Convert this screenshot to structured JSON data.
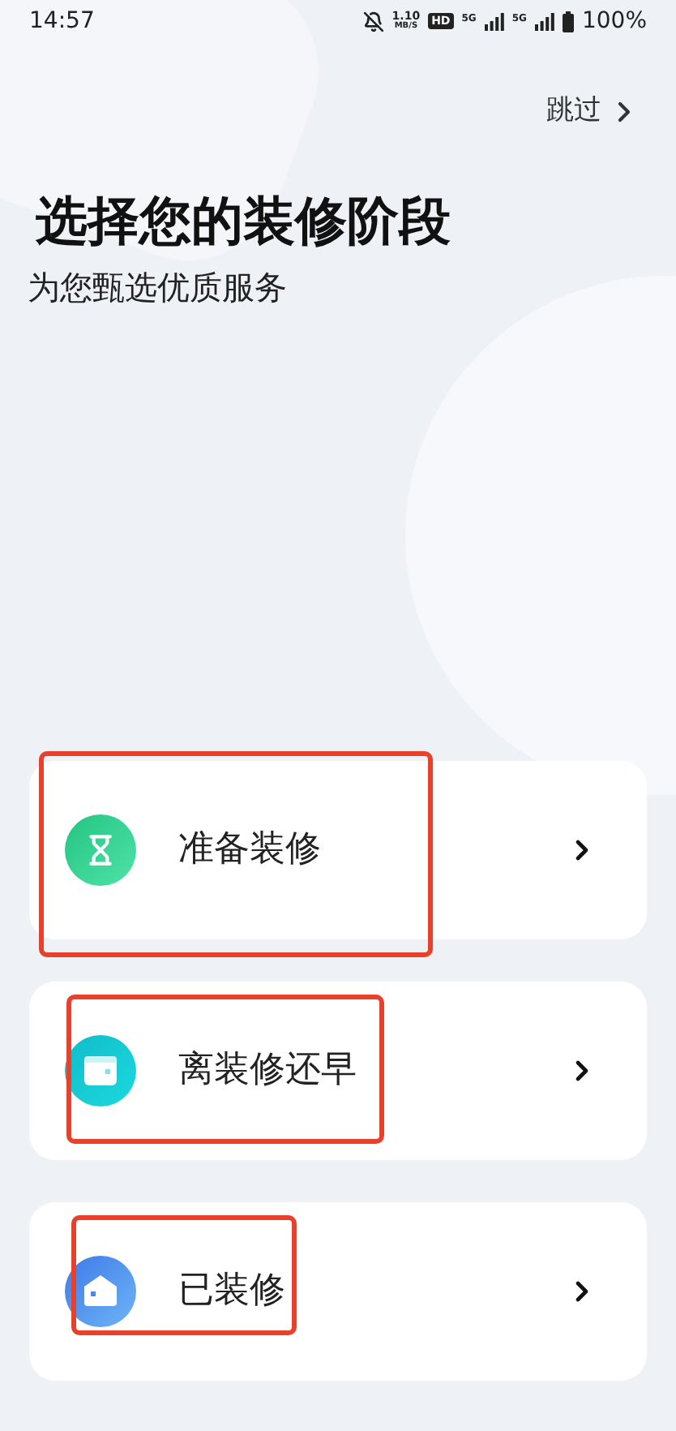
{
  "status_bar": {
    "time": "14:57",
    "speed_value": "1.10",
    "speed_unit": "MB/S",
    "hd": "HD",
    "network_1": "5G",
    "network_2": "5G",
    "battery": "100%"
  },
  "skip": {
    "label": "跳过"
  },
  "title": "选择您的装修阶段",
  "subtitle": "为您甄选优质服务",
  "options": [
    {
      "kind": "preparing",
      "label": "准备装修",
      "highlighted": true
    },
    {
      "kind": "early",
      "label": "离装修还早",
      "highlighted": true
    },
    {
      "kind": "done",
      "label": "已装修",
      "highlighted": true
    }
  ]
}
